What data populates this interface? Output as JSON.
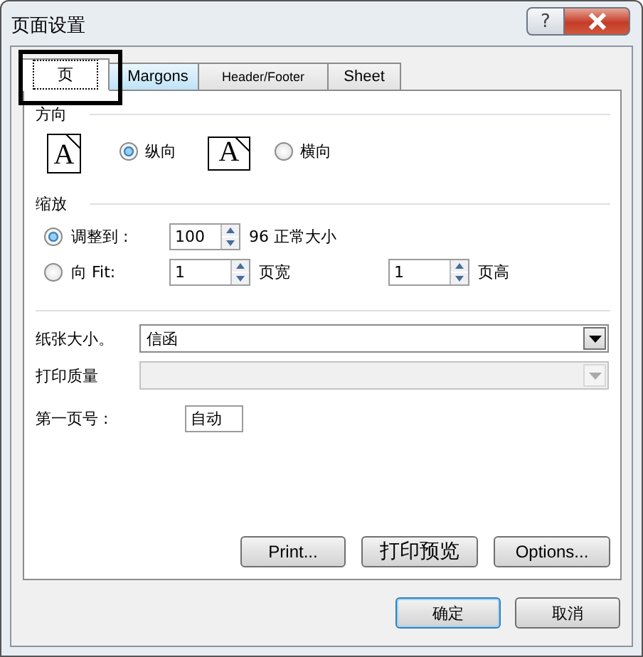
{
  "window": {
    "title": "页面设置",
    "help": "?"
  },
  "tabs": [
    {
      "label": "页",
      "selected": true
    },
    {
      "label": "Margons",
      "selected": false
    },
    {
      "label": "Header/Footer",
      "selected": false
    },
    {
      "label": "Sheet",
      "selected": false
    }
  ],
  "orientation": {
    "heading": "方向",
    "options": [
      {
        "label": "纵向",
        "icon_letter": "A",
        "kind": "portrait",
        "selected": true
      },
      {
        "label": "横向",
        "icon_letter": "A",
        "kind": "landscape",
        "selected": false
      }
    ]
  },
  "scaling": {
    "heading": "缩放",
    "adjust": {
      "label": "调整到 :",
      "selected": true,
      "value": "100",
      "suffix": "96 正常大小"
    },
    "fit": {
      "label": "向 Fit:",
      "selected": false,
      "wide_value": "1",
      "wide_label": "页宽",
      "tall_value": "1",
      "tall_label": "页高"
    }
  },
  "paper_size": {
    "label": "纸张大小。",
    "value": "信函",
    "disabled": false
  },
  "print_quality": {
    "label": "打印质量",
    "disabled": true
  },
  "first_page_number": {
    "label": "第一页号 :",
    "value": "自动"
  },
  "panel_buttons": [
    "Print...",
    "打印预览",
    "Options..."
  ],
  "dialog_buttons": [
    {
      "label": "确定",
      "default": true
    },
    {
      "label": "取消",
      "default": false
    }
  ]
}
